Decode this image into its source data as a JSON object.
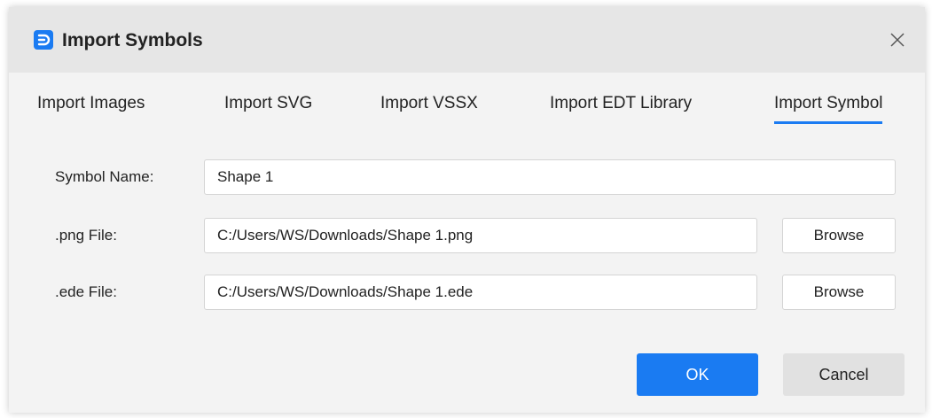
{
  "dialog": {
    "title": "Import Symbols",
    "icons": {
      "app": "app-logo-icon",
      "close": "close-icon"
    },
    "accent_color": "#1a7bf2"
  },
  "tabs": [
    {
      "label": "Import Images",
      "active": false
    },
    {
      "label": "Import SVG",
      "active": false
    },
    {
      "label": "Import VSSX",
      "active": false
    },
    {
      "label": "Import EDT Library",
      "active": false
    },
    {
      "label": "Import Symbol",
      "active": true
    }
  ],
  "form": {
    "symbol_name": {
      "label": "Symbol Name:",
      "value": "Shape 1"
    },
    "png_file": {
      "label": ".png File:",
      "value": "C:/Users/WS/Downloads/Shape 1.png",
      "browse_label": "Browse"
    },
    "ede_file": {
      "label": ".ede File:",
      "value": "C:/Users/WS/Downloads/Shape 1.ede",
      "browse_label": "Browse"
    }
  },
  "footer": {
    "ok_label": "OK",
    "cancel_label": "Cancel"
  }
}
